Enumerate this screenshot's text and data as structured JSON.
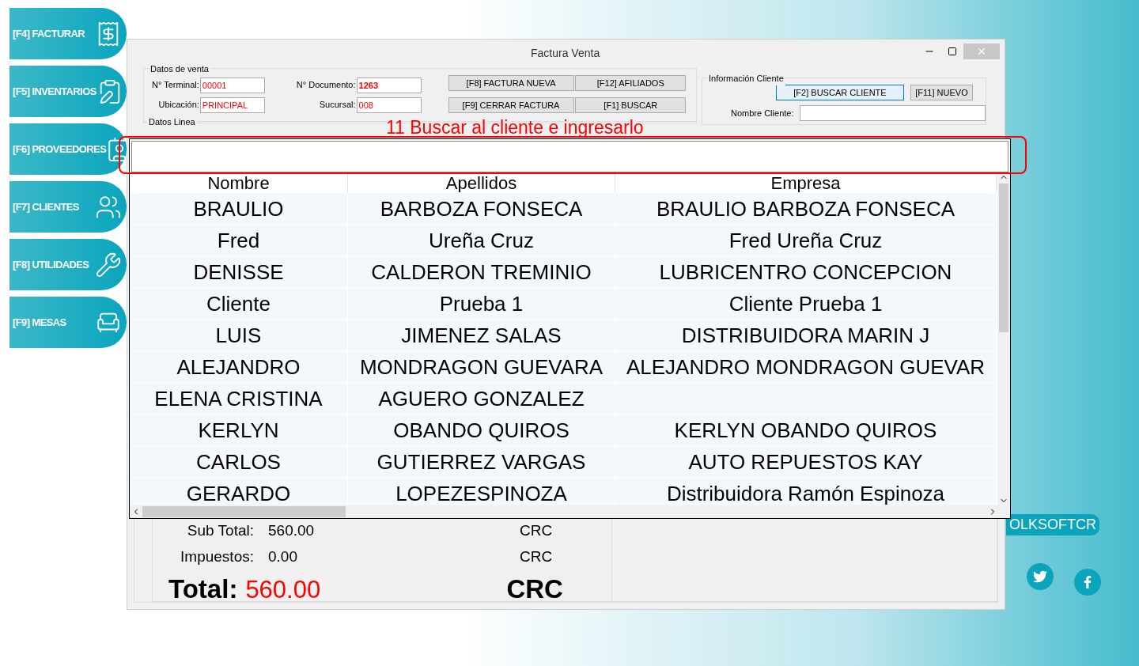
{
  "sidebar": {
    "items": [
      {
        "label": "[F4] FACTURAR",
        "kind": "invoice"
      },
      {
        "label": "[F5] INVENTARIOS",
        "kind": "inventory"
      },
      {
        "label": "[F6] PROVEEDORES",
        "kind": "suppliers"
      },
      {
        "label": "[F7] CLIENTES",
        "kind": "clients"
      },
      {
        "label": "[F8] UTILIDADES",
        "kind": "utilities"
      },
      {
        "label": "[F9] MESAS",
        "kind": "tables"
      }
    ]
  },
  "window": {
    "title": "Factura Venta"
  },
  "datos_venta": {
    "title": "Datos de venta",
    "fields": [
      {
        "label": "N° Terminal:",
        "value": "00001",
        "bold": false
      },
      {
        "label": "N° Documento:",
        "value": "1263",
        "bold": true
      },
      {
        "label": "Ubicación:",
        "value": "PRINCIPAL",
        "bold": false
      },
      {
        "label": "Sucursal:",
        "value": "008",
        "bold": false
      }
    ],
    "buttons": [
      "[F8] FACTURA NUEVA",
      "[F12] AFILIADOS",
      "[F9] CERRAR FACTURA",
      "[F1] BUSCAR"
    ]
  },
  "datos_linea": {
    "title": "Datos Linea"
  },
  "cliente": {
    "title": "Información Cliente",
    "buttons": [
      {
        "label": "[F2] BUSCAR CLIENTE",
        "focused": true
      },
      {
        "label": "[F11] NUEVO",
        "focused": false
      }
    ],
    "name_label": "Nombre Cliente:"
  },
  "annotation": "11  Buscar al cliente e ingresarlo",
  "grid": {
    "columns": [
      "Nombre",
      "Apellidos",
      "Empresa"
    ],
    "rows": [
      {
        "nombre": "BRAULIO",
        "apellidos": "BARBOZA FONSECA",
        "empresa": "BRAULIO BARBOZA FONSECA"
      },
      {
        "nombre": "Fred",
        "apellidos": "Ureña Cruz",
        "empresa": "Fred Ureña Cruz"
      },
      {
        "nombre": "DENISSE",
        "apellidos": "CALDERON TREMINIO",
        "empresa": "LUBRICENTRO CONCEPCION"
      },
      {
        "nombre": "Cliente",
        "apellidos": "Prueba 1",
        "empresa": "Cliente Prueba 1"
      },
      {
        "nombre": "LUIS",
        "apellidos": "JIMENEZ SALAS",
        "empresa": "DISTRIBUIDORA MARIN J"
      },
      {
        "nombre": "ALEJANDRO",
        "apellidos": "MONDRAGON GUEVARA",
        "empresa": "ALEJANDRO MONDRAGON GUEVAR"
      },
      {
        "nombre": "ELENA CRISTINA",
        "apellidos": "AGUERO GONZALEZ"
      },
      {
        "nombre": "KERLYN",
        "apellidos": "OBANDO QUIROS",
        "empresa": "KERLYN OBANDO QUIROS"
      },
      {
        "nombre": "CARLOS",
        "apellidos": "GUTIERREZ VARGAS",
        "empresa": "AUTO REPUESTOS KAY"
      },
      {
        "nombre": "GERARDO",
        "apellidos": "LOPEZESPINOZA",
        "empresa": "Distribuidora Ramón Espinoza"
      }
    ]
  },
  "totals": {
    "subtotal_label": "Sub Total:",
    "subtotal": "560.00",
    "subtotal_currency": "CRC",
    "tax_label": "Impuestos:",
    "tax": "0.00",
    "tax_currency": "CRC",
    "total_label": "Total:",
    "total": "560.00",
    "total_currency": "CRC"
  },
  "brand": "OLKSOFTCR"
}
